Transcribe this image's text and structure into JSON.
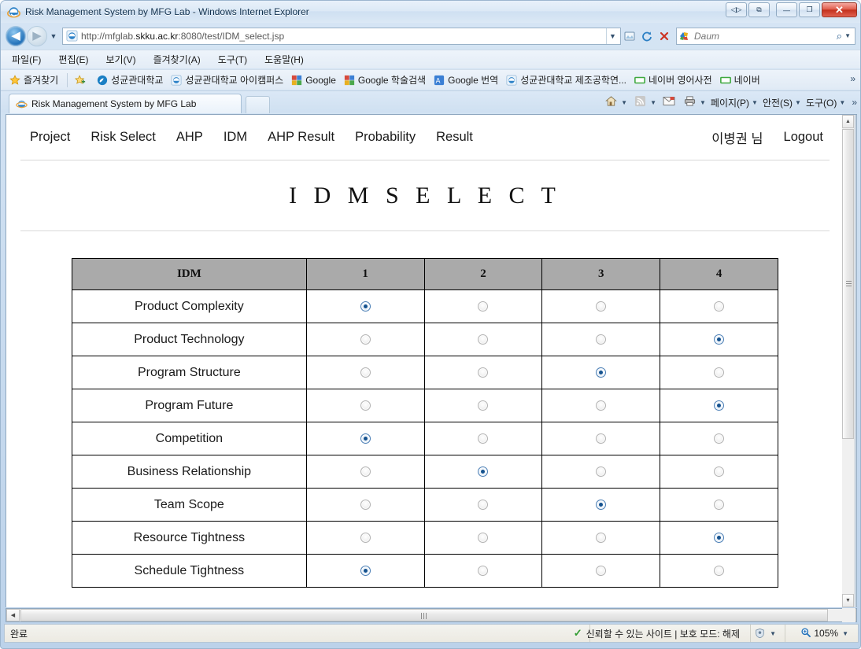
{
  "window": {
    "title": "Risk Management System by MFG Lab - Windows Internet Explorer",
    "caption_buttons": [
      {
        "name": "compat-view-button",
        "glyph": "◁▷"
      },
      {
        "name": "restore-tabs-button",
        "glyph": "⧉"
      },
      {
        "name": "minimize-button",
        "glyph": "—"
      },
      {
        "name": "maximize-button",
        "glyph": "❐"
      },
      {
        "name": "close-button",
        "glyph": "✕"
      }
    ]
  },
  "address_bar": {
    "back_glyph": "◀",
    "forward_glyph": "▶",
    "history_caret": "▼",
    "url_prefix": "http://mfglab.",
    "url_domain": "skku.ac.kr",
    "url_suffix": ":8080/test/IDM_select.jsp",
    "url_full": "http://mfglab.skku.ac.kr:8080/test/IDM_select.jsp",
    "dropdown_caret": "▼",
    "compat_glyph": "▧",
    "refresh_glyph": "↻",
    "stop_glyph": "✕",
    "search_placeholder": "Daum",
    "search_glyph": "🔍",
    "search_caret": "▼"
  },
  "menu_bar": {
    "items": [
      {
        "name": "menu-file",
        "label": "파일(F)"
      },
      {
        "name": "menu-edit",
        "label": "편집(E)"
      },
      {
        "name": "menu-view",
        "label": "보기(V)"
      },
      {
        "name": "menu-favorites",
        "label": "즐겨찾기(A)"
      },
      {
        "name": "menu-tools",
        "label": "도구(T)"
      },
      {
        "name": "menu-help",
        "label": "도움말(H)"
      }
    ]
  },
  "favorites_bar": {
    "favorites_label": "즐겨찾기",
    "overflow_glyph": "»",
    "items": [
      {
        "name": "fav-add-to-favorites-bar",
        "label": "",
        "icon": "add-favorite-icon"
      },
      {
        "name": "fav-skku",
        "label": "성균관대학교",
        "icon": "skku-icon"
      },
      {
        "name": "fav-skku-icampus",
        "label": "성균관대학교 아이캠퍼스",
        "icon": "ie-icon"
      },
      {
        "name": "fav-google",
        "label": "Google",
        "icon": "google-icon"
      },
      {
        "name": "fav-google-scholar",
        "label": "Google 학술검색",
        "icon": "google-icon"
      },
      {
        "name": "fav-google-translate",
        "label": "Google 번역",
        "icon": "google-translate-icon"
      },
      {
        "name": "fav-skku-mfg",
        "label": "성균관대학교 제조공학연...",
        "icon": "ie-icon"
      },
      {
        "name": "fav-naver-dict",
        "label": "네이버 영어사전",
        "icon": "naver-icon"
      },
      {
        "name": "fav-naver",
        "label": "네이버",
        "icon": "naver-icon"
      }
    ]
  },
  "tabs": {
    "open": [
      {
        "name": "tab-risk-management-system",
        "label": "Risk Management System by MFG Lab"
      }
    ],
    "new_tab_label": ""
  },
  "command_bar": {
    "items": [
      {
        "name": "home-button",
        "glyph": "⌂",
        "label": "",
        "caret": "▼"
      },
      {
        "name": "feeds-button",
        "glyph": "📶",
        "label": "",
        "caret": "▼"
      },
      {
        "name": "mail-button",
        "glyph": "✉",
        "label": "",
        "caret": ""
      },
      {
        "name": "print-button",
        "glyph": "🖶",
        "label": "",
        "caret": "▼"
      },
      {
        "name": "page-menu",
        "glyph": "",
        "label": "페이지(P)",
        "caret": "▼"
      },
      {
        "name": "safety-menu",
        "glyph": "",
        "label": "안전(S)",
        "caret": "▼"
      },
      {
        "name": "tools-menu",
        "glyph": "",
        "label": "도구(O)",
        "caret": "▼"
      }
    ],
    "overflow_glyph": "»"
  },
  "page": {
    "nav": [
      {
        "name": "nav-project",
        "label": "Project"
      },
      {
        "name": "nav-risk-select",
        "label": "Risk Select"
      },
      {
        "name": "nav-ahp",
        "label": "AHP"
      },
      {
        "name": "nav-idm",
        "label": "IDM"
      },
      {
        "name": "nav-ahp-result",
        "label": "AHP Result"
      },
      {
        "name": "nav-probability",
        "label": "Probability"
      },
      {
        "name": "nav-result",
        "label": "Result"
      }
    ],
    "user_label": "이병권 님",
    "logout_label": "Logout",
    "title": "I D M   S E L E C T",
    "table": {
      "headers": [
        "IDM",
        "1",
        "2",
        "3",
        "4"
      ],
      "rows": [
        {
          "label": "Product Complexity",
          "selected": 1
        },
        {
          "label": "Product Technology",
          "selected": 4
        },
        {
          "label": "Program Structure",
          "selected": 3
        },
        {
          "label": "Program Future",
          "selected": 4
        },
        {
          "label": "Competition",
          "selected": 1
        },
        {
          "label": "Business Relationship",
          "selected": 2
        },
        {
          "label": "Team Scope",
          "selected": 3
        },
        {
          "label": "Resource Tightness",
          "selected": 4
        },
        {
          "label": "Schedule Tightness",
          "selected": 1
        }
      ]
    }
  },
  "scrollbars": {
    "v_up_glyph": "▲",
    "v_down_glyph": "▼",
    "h_left_glyph": "◀",
    "h_right_glyph": "▶"
  },
  "status_bar": {
    "status_text": "완료",
    "zone_check": "✓",
    "zone_text": "신뢰할 수 있는 사이트 | 보호 모드: 해제",
    "privacy_glyph": "⛨",
    "privacy_caret": "▼",
    "zoom_glyph": "🔍",
    "zoom_level": "105%",
    "zoom_caret": "▼"
  },
  "colors": {
    "table_header_bg": "#aaaaaa",
    "table_border": "#000000",
    "radio_selected": "#15528f",
    "page_bg": "#ffffff"
  }
}
